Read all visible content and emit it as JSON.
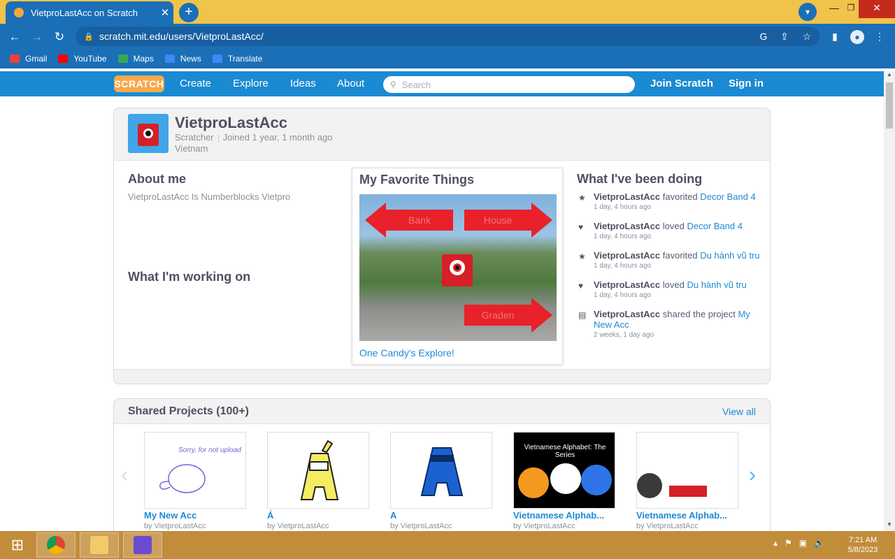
{
  "browser": {
    "tab_title": "VietproLastAcc on Scratch",
    "url": "scratch.mit.edu/users/VietproLastAcc/",
    "bookmarks": [
      {
        "label": "Gmail",
        "color": "#ea4335"
      },
      {
        "label": "YouTube",
        "color": "#ff0000"
      },
      {
        "label": "Maps",
        "color": "#34a853"
      },
      {
        "label": "News",
        "color": "#4285f4"
      },
      {
        "label": "Translate",
        "color": "#4285f4"
      }
    ]
  },
  "nav": {
    "logo": "SCRATCH",
    "create": "Create",
    "explore": "Explore",
    "ideas": "Ideas",
    "about": "About",
    "search_placeholder": "Search",
    "join": "Join Scratch",
    "signin": "Sign in"
  },
  "profile": {
    "username": "VietproLastAcc",
    "role": "Scratcher",
    "joined": "Joined 1 year, 1 month ago",
    "country": "Vietnam",
    "about_title": "About me",
    "about_text": "VietproLastAcc Is Numberblocks Vietpro",
    "working_title": "What I'm working on",
    "favorite": {
      "title": "My Favorite Things",
      "project_title": "One Candy's Explore!",
      "arrow_labels": [
        "Bank",
        "House",
        "Graden"
      ]
    },
    "activity_title": "What I've been doing",
    "activity": [
      {
        "icon": "star-icon",
        "glyph": "★",
        "who": "VietproLastAcc",
        "verb": "favorited",
        "object": "Decor Band 4",
        "when": "1 day, 4 hours ago"
      },
      {
        "icon": "heart-icon",
        "glyph": "♥",
        "who": "VietproLastAcc",
        "verb": "loved",
        "object": "Decor Band 4",
        "when": "1 day, 4 hours ago"
      },
      {
        "icon": "star-icon",
        "glyph": "★",
        "who": "VietproLastAcc",
        "verb": "favorited",
        "object": "Du hành vũ tru",
        "when": "1 day, 4 hours ago"
      },
      {
        "icon": "heart-icon",
        "glyph": "♥",
        "who": "VietproLastAcc",
        "verb": "loved",
        "object": "Du hành vũ tru",
        "when": "1 day, 4 hours ago"
      },
      {
        "icon": "share-icon",
        "glyph": "▤",
        "who": "VietproLastAcc",
        "verb": "shared the project",
        "object": "My New Acc",
        "when": "2 weeks, 1 day ago"
      }
    ]
  },
  "shared": {
    "title": "Shared Projects (100+)",
    "view_all": "View all",
    "projects": [
      {
        "title": "My New Acc",
        "by": "by VietproLastAcc",
        "thumb_text": "Sorry, for not upload",
        "bg": "#ffffff"
      },
      {
        "title": "Á",
        "by": "by VietproLastAcc",
        "thumb_text": "",
        "bg": "#ffffff"
      },
      {
        "title": "A",
        "by": "by VietproLastAcc",
        "thumb_text": "",
        "bg": "#ffffff"
      },
      {
        "title": "Vietnamese Alphab...",
        "by": "by VietproLastAcc",
        "thumb_text": "Vietnamese Alphabet: The Series",
        "bg": "#000000"
      },
      {
        "title": "Vietnamese Alphab...",
        "by": "by VietproLastAcc",
        "thumb_text": "",
        "bg": "#ffffff"
      }
    ]
  },
  "taskbar": {
    "time": "7:21 AM",
    "date": "5/8/2023"
  }
}
